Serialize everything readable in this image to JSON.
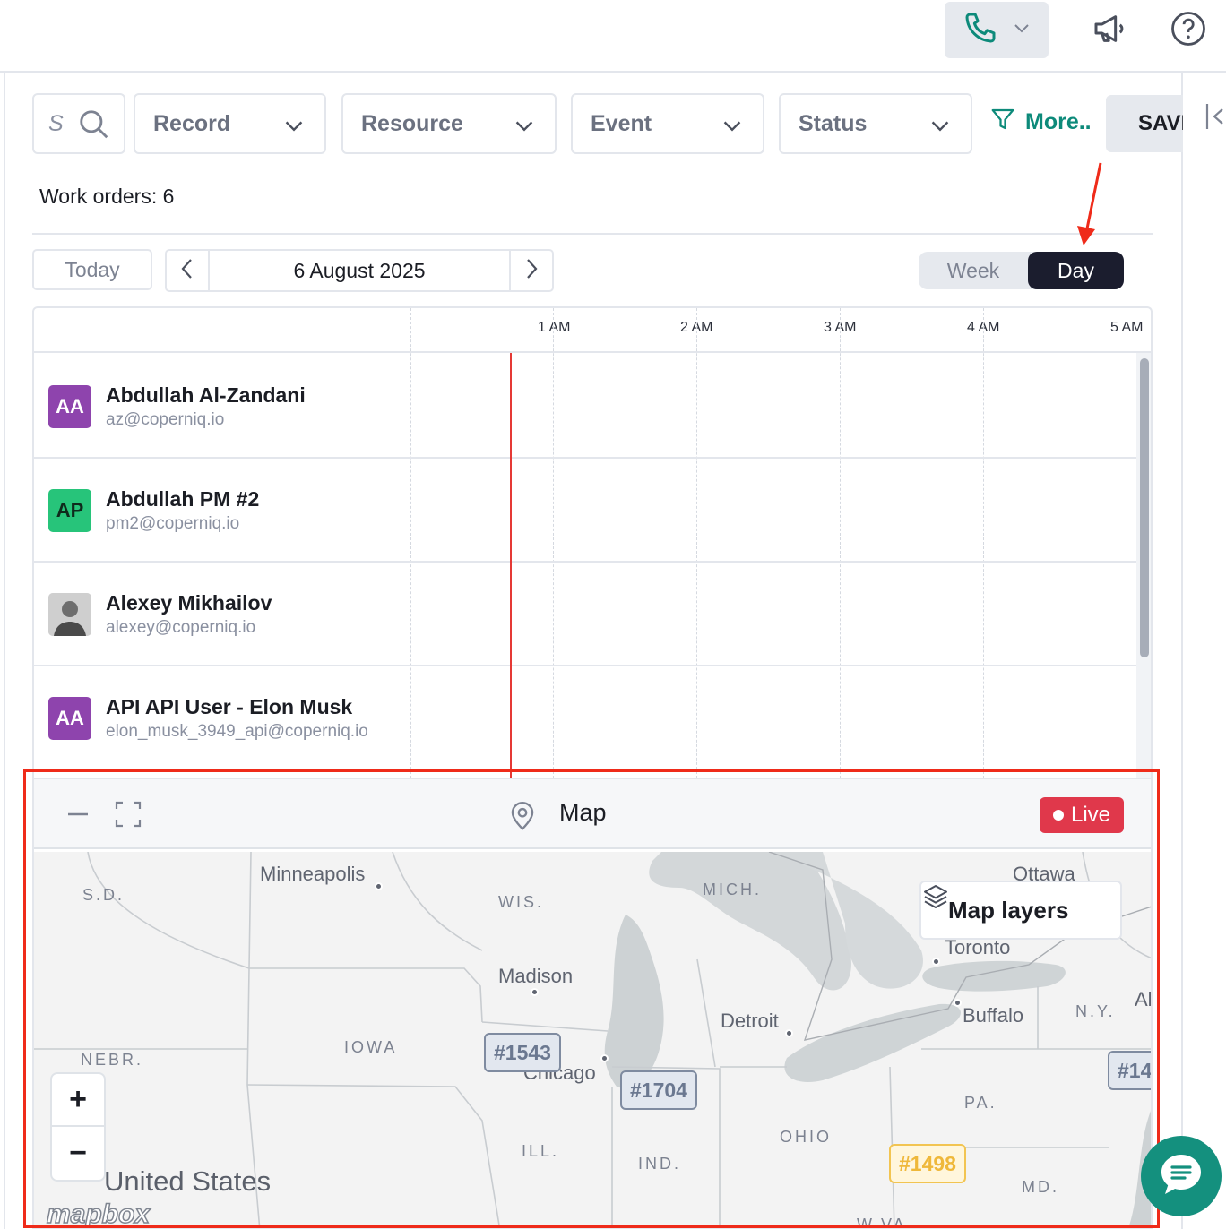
{
  "topbar": {
    "phone_icon": "phone-icon",
    "megaphone_icon": "megaphone-icon",
    "help_icon": "help-circle-icon"
  },
  "filters": {
    "search_placeholder": "S",
    "record": "Record",
    "resource": "Resource",
    "event": "Event",
    "status": "Status",
    "more": "More..",
    "save": "SAVE"
  },
  "summary": {
    "work_orders": "Work orders: 6"
  },
  "date_nav": {
    "today": "Today",
    "date": "6 August 2025",
    "views": {
      "week": "Week",
      "day": "Day"
    },
    "active_view": "Day"
  },
  "timeline": {
    "hours": [
      "1 AM",
      "2 AM",
      "3 AM",
      "4 AM",
      "5 AM"
    ]
  },
  "resources": [
    {
      "initials": "AA",
      "name": "Abdullah Al-Zandani",
      "email": "az@coperniq.io",
      "color": "#8e44ad"
    },
    {
      "initials": "AP",
      "name": "Abdullah PM #2",
      "email": "pm2@coperniq.io",
      "color": "#27c47a"
    },
    {
      "initials": "",
      "name": "Alexey Mikhailov",
      "email": "alexey@coperniq.io",
      "color": "#9a9a9a"
    },
    {
      "initials": "AA",
      "name": "API API User - Elon Musk",
      "email": "elon_musk_3949_api@coperniq.io",
      "color": "#8e44ad"
    }
  ],
  "map": {
    "title": "Map",
    "live": "Live",
    "layers": "Map layers",
    "zoom_in": "+",
    "zoom_out": "−",
    "country": "United States",
    "attribution": "mapbox",
    "places": {
      "minneapolis": "Minneapolis",
      "madison": "Madison",
      "detroit": "Detroit",
      "toronto": "Toronto",
      "buffalo": "Buffalo",
      "ottawa": "Ottawa",
      "chicago": "Chicago",
      "al": "Al"
    },
    "states": {
      "sd": "S.D.",
      "wis": "WIS.",
      "mich": "MICH.",
      "iowa": "IOWA",
      "nebr": "NEBR.",
      "ill": "ILL.",
      "ind": "IND.",
      "ohio": "OHIO",
      "pa": "PA.",
      "ny": "N.Y.",
      "md": "MD.",
      "wva": "W.VA."
    },
    "markers": [
      "#1543",
      "#1704",
      "#1498",
      "#14"
    ]
  },
  "colors": {
    "accent": "#0d8a7a",
    "dark": "#1b1d2e",
    "live": "#e0384b",
    "highlight": "#ef2b1a",
    "marker_yellow": "#f2c451"
  }
}
